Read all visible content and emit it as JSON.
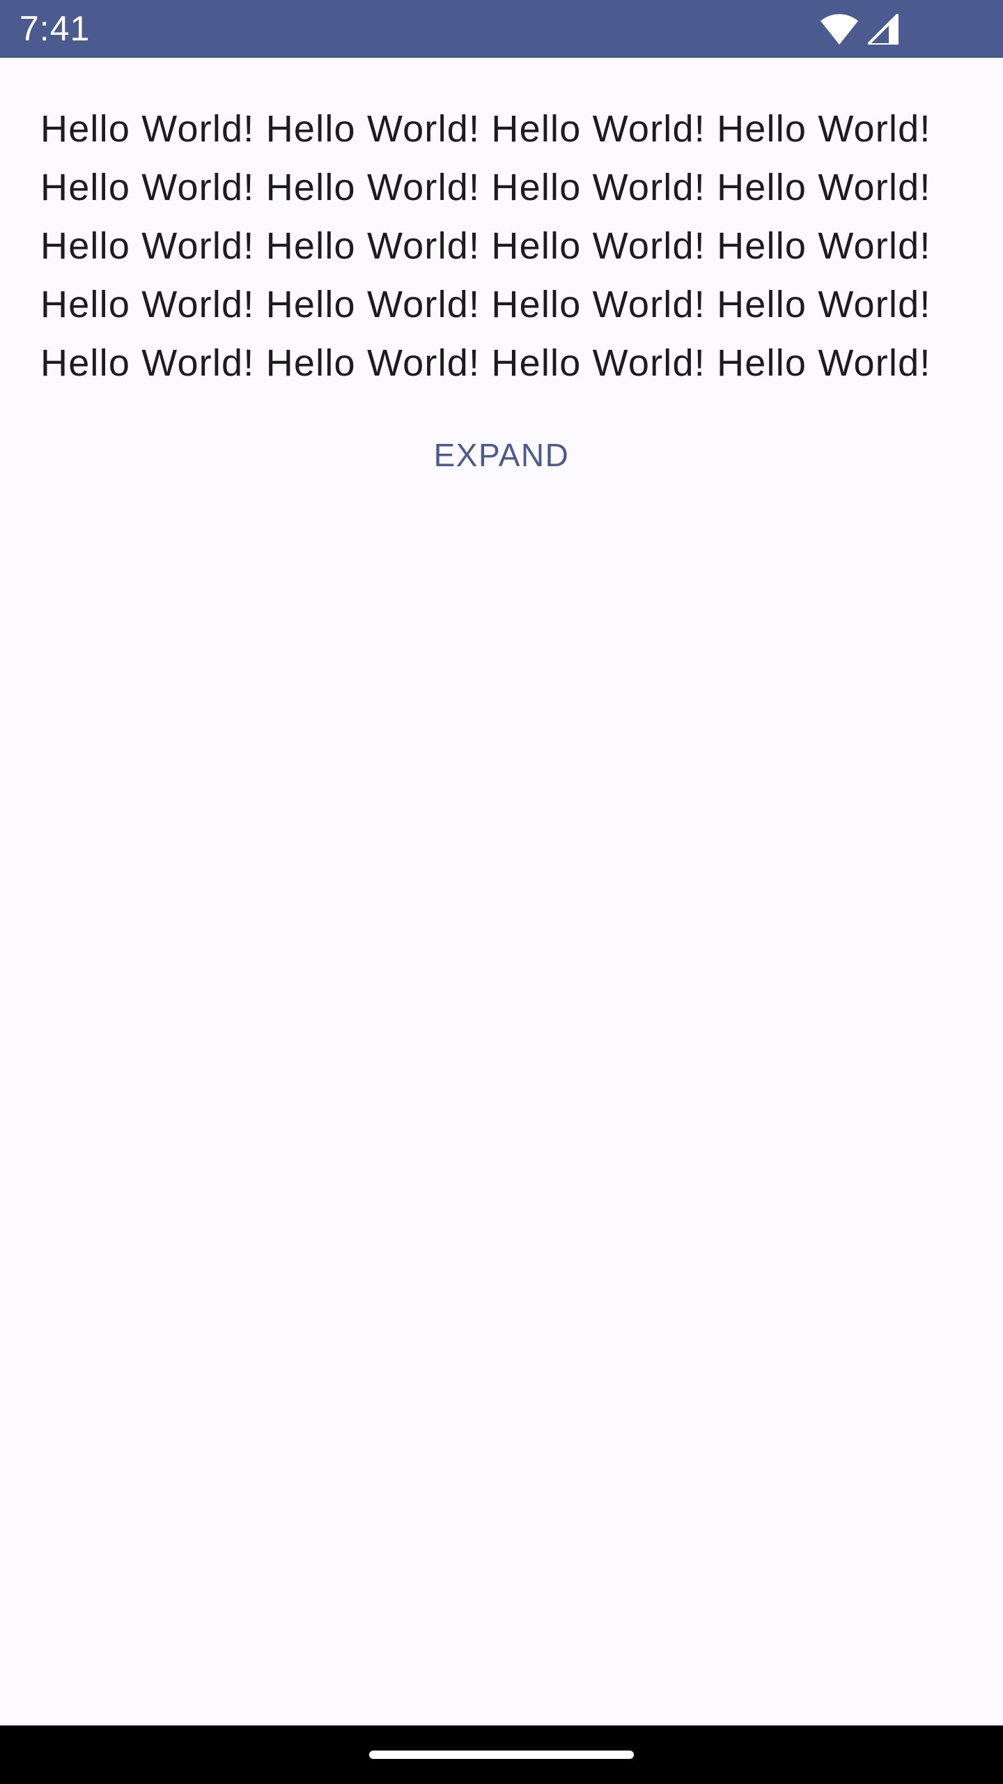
{
  "status_bar": {
    "time": "7:41",
    "icons": [
      "wifi-icon",
      "cell-signal-icon"
    ],
    "background": "#4b5b8f"
  },
  "main": {
    "text": "Hello World! Hello World! Hello World! Hello World! Hello World! Hello World! Hello World! Hello World! Hello World! Hello World! Hello World! Hello World! Hello World! Hello World! Hello World! Hello World! Hello World! Hello World! Hello World! Hello World!",
    "expand_label": "EXPAND",
    "max_lines": 5,
    "accent": "#4b5b8f",
    "text_color": "#1b1b21",
    "background": "#fcfaff"
  },
  "nav_bar": {
    "type": "gesture",
    "background": "#000000"
  }
}
